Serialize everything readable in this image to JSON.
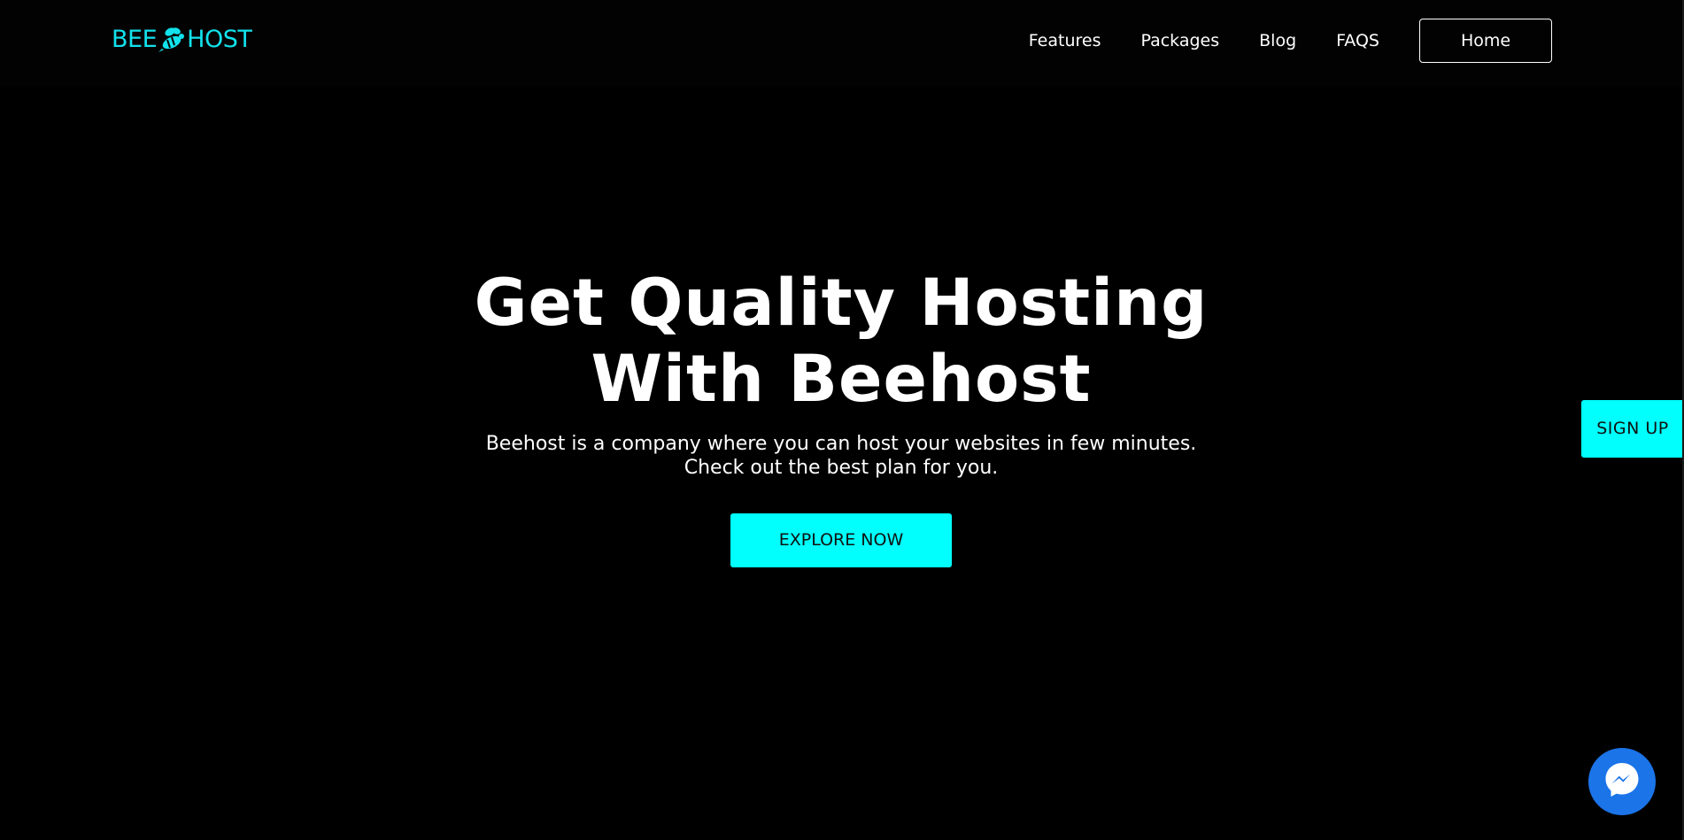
{
  "brand": {
    "logo_left": "BEE",
    "logo_right": "HOST",
    "logo_icon": "bee-icon",
    "accent_color": "#12e2ec"
  },
  "nav": {
    "items": [
      {
        "label": "Features"
      },
      {
        "label": "Packages"
      },
      {
        "label": "Blog"
      },
      {
        "label": "FAQS"
      }
    ],
    "home_label": "Home"
  },
  "hero": {
    "title_line1": "Get Quality Hosting",
    "title_line2": "With Beehost",
    "subtitle_line1": "Beehost is a company where you can host your websites in few minutes.",
    "subtitle_line2": "Check out the best plan for you.",
    "cta_label": "EXPLORE NOW",
    "cta_color": "#00fffd"
  },
  "side_tab": {
    "label": "SIGN UP"
  },
  "chat": {
    "icon": "messenger-icon",
    "color": "#1b74e8"
  }
}
